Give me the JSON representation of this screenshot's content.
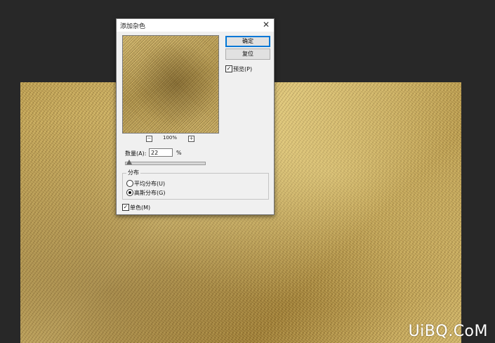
{
  "dialog": {
    "title": "添加杂色",
    "close_glyph": "✕",
    "zoom_out": "−",
    "zoom_in": "+",
    "zoom_level": "100%",
    "ok_label": "确定",
    "reset_label": "复位",
    "preview_label": "预览(P)",
    "preview_checked": true,
    "amount_label": "数量(A):",
    "amount_value": "22",
    "amount_unit": "%",
    "amount_percent": 22,
    "distribution_label": "分布",
    "uniform_label": "平均分布(U)",
    "gaussian_label": "高斯分布(G)",
    "selected_distribution": "gaussian",
    "monochrome_label": "单色(M)",
    "monochrome_checked": true
  },
  "checkmark": "✓",
  "watermark": "UiBQ.CoM",
  "colors": {
    "workspace": "#282828",
    "gold": "#c9ad63",
    "dialog_bg": "#f0f0f0",
    "default_button_border": "#0078d7"
  }
}
